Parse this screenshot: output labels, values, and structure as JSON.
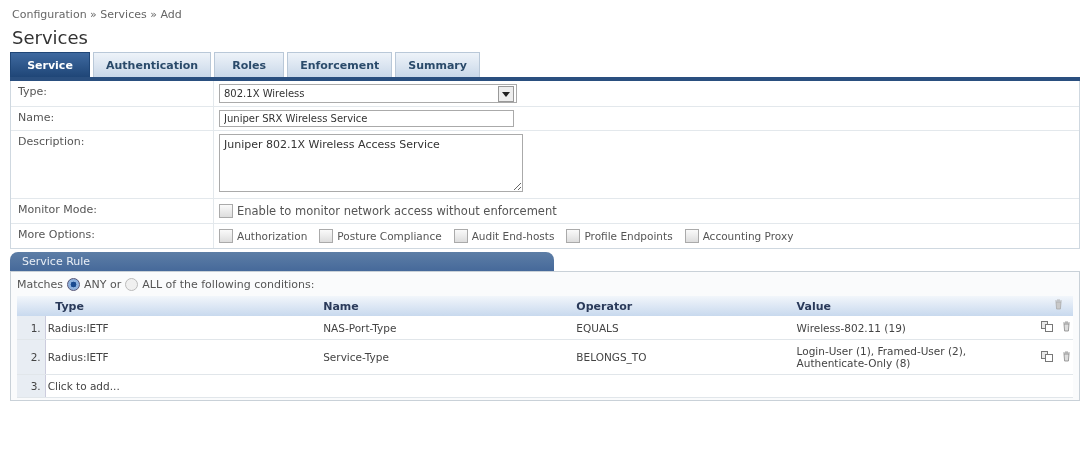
{
  "breadcrumb": "Configuration » Services » Add",
  "title": "Services",
  "tabs": [
    {
      "label": "Service",
      "selected": true
    },
    {
      "label": "Authentication",
      "selected": false
    },
    {
      "label": "Roles",
      "selected": false
    },
    {
      "label": "Enforcement",
      "selected": false
    },
    {
      "label": "Summary",
      "selected": false
    }
  ],
  "form": {
    "type": {
      "label": "Type:",
      "value": "802.1X Wireless"
    },
    "name": {
      "label": "Name:",
      "value": "Juniper SRX Wireless Service"
    },
    "description": {
      "label": "Description:",
      "value": "Juniper 802.1X Wireless Access Service"
    },
    "monitor_mode": {
      "label": "Monitor Mode:",
      "option": {
        "label": "Enable to monitor network access without enforcement",
        "checked": false
      }
    },
    "more_options": {
      "label": "More Options:",
      "options": [
        {
          "label": "Authorization",
          "checked": false
        },
        {
          "label": "Posture Compliance",
          "checked": false
        },
        {
          "label": "Audit End-hosts",
          "checked": false
        },
        {
          "label": "Profile Endpoints",
          "checked": false
        },
        {
          "label": "Accounting Proxy",
          "checked": false
        }
      ]
    }
  },
  "service_rule": {
    "title": "Service Rule",
    "matches": {
      "prefix": "Matches",
      "options": [
        {
          "label": "ANY or",
          "selected": true
        },
        {
          "label": "ALL of the following conditions:",
          "selected": false
        }
      ]
    },
    "columns": [
      "Type",
      "Name",
      "Operator",
      "Value"
    ],
    "rows": [
      {
        "number": "1.",
        "type": "Radius:IETF",
        "name": "NAS-Port-Type",
        "operator": "EQUALS",
        "value": "Wireless-802.11 (19)"
      },
      {
        "number": "2.",
        "type": "Radius:IETF",
        "name": "Service-Type",
        "operator": "BELONGS_TO",
        "value": "Login-User (1), Framed-User (2), Authenticate-Only (8)"
      }
    ],
    "add_row": {
      "number": "3.",
      "label": "Click to add..."
    }
  }
}
